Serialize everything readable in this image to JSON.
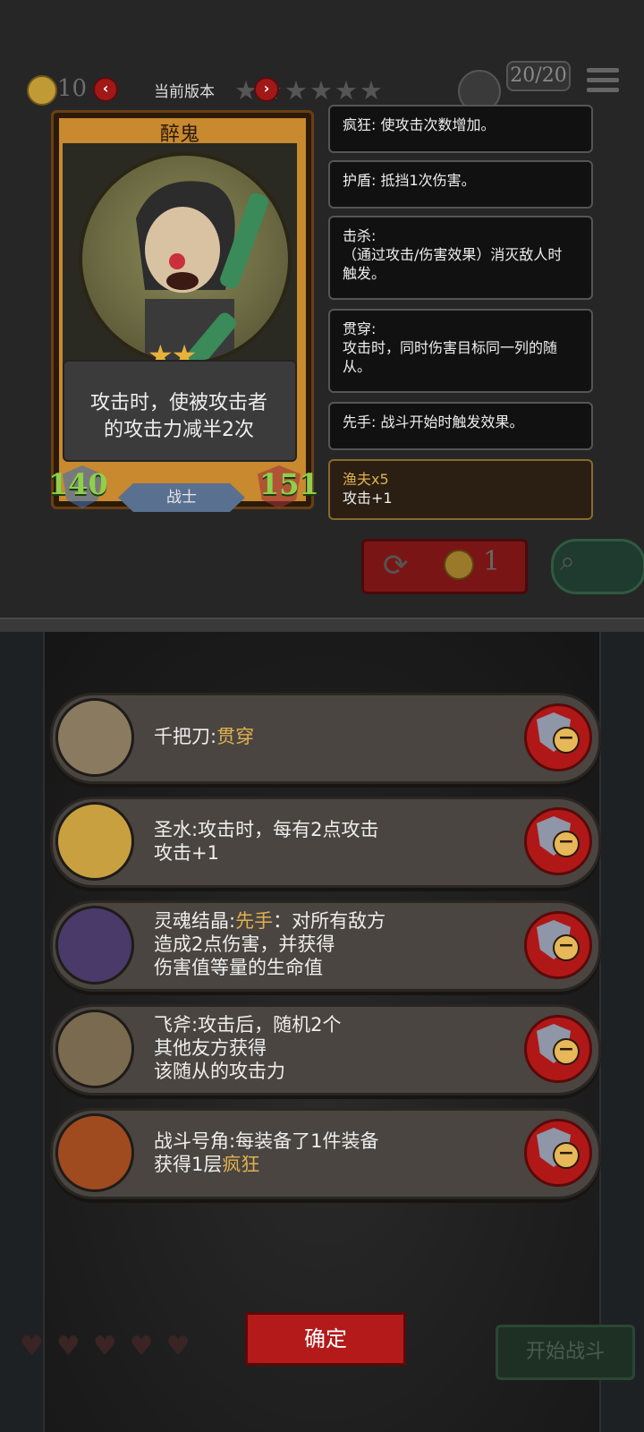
{
  "header": {
    "coin_count": "10",
    "version_label": "当前版本",
    "stars": "★★★★★★",
    "energy": "20/20"
  },
  "card": {
    "name": "醉鬼",
    "stars": "★★",
    "description_line1": "攻击时，使被攻击者",
    "description_line2": "的攻击力减半2次",
    "attack": "140",
    "health": "151",
    "class": "战士"
  },
  "keywords": [
    {
      "lines": [
        "疯狂: 使攻击次数增加。"
      ]
    },
    {
      "lines": [
        "护盾: 抵挡1次伤害。"
      ]
    },
    {
      "lines": [
        "击杀:",
        "（通过攻击/伤害效果）消灭敌人时",
        "触发。"
      ]
    },
    {
      "lines": [
        "贯穿:",
        "攻击时，同时伤害目标同一列的随",
        "从。"
      ]
    },
    {
      "lines": [
        "先手: 战斗开始时触发效果。"
      ]
    },
    {
      "lines": [
        "渔夫x5",
        "攻击+1"
      ]
    }
  ],
  "reroll": {
    "cost": "1"
  },
  "equipment": [
    {
      "name": "千把刀:",
      "keyword": "贯穿",
      "lines": [
        ""
      ],
      "icon": "knives-icon"
    },
    {
      "name": "圣水:",
      "keyword": "",
      "lines": [
        "攻击时，每有2点攻击",
        "攻击+1"
      ],
      "icon": "holy-water-icon"
    },
    {
      "name": "灵魂结晶:",
      "keyword": "先手",
      "lines": [
        "：对所有敌方",
        "造成2点伤害，并获得",
        "伤害值等量的生命值"
      ],
      "icon": "soul-crystal-icon"
    },
    {
      "name": "飞斧:",
      "keyword": "",
      "lines": [
        "攻击后，随机2个",
        "其他友方获得",
        "该随从的攻击力"
      ],
      "icon": "axe-icon"
    },
    {
      "name": "战斗号角:",
      "keyword": "",
      "lines": [
        "每装备了1件装备",
        "获得1层"
      ],
      "tail_keyword": "疯狂",
      "icon": "horn-icon"
    }
  ],
  "buttons": {
    "confirm": "确定",
    "start_battle": "开始战斗"
  },
  "lives": "♥♥♥♥♥"
}
